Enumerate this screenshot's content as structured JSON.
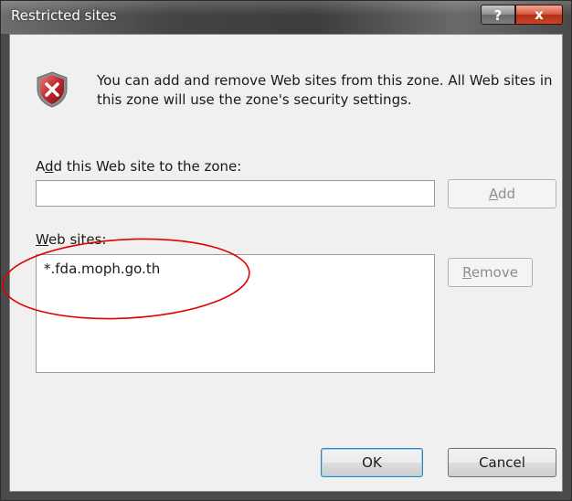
{
  "window": {
    "title": "Restricted sites"
  },
  "title_buttons": {
    "help": "?",
    "close": "x"
  },
  "description": "You can add and remove Web sites from this zone. All Web sites in this zone will use the zone's security settings.",
  "add_site": {
    "label_before": "A",
    "label_mnemonic": "d",
    "label_after": "d this Web site to the zone:",
    "value": "",
    "add_button_mnemonic": "A",
    "add_button_rest": "dd"
  },
  "web_sites": {
    "label_mnemonic": "W",
    "label_rest": "eb sites:",
    "items": [
      "*.fda.moph.go.th"
    ],
    "remove_button_mnemonic": "R",
    "remove_button_rest": "emove"
  },
  "footer": {
    "ok": "OK",
    "cancel": "Cancel"
  },
  "colors": {
    "annotation": "#e00000",
    "shield": "#c0272d"
  },
  "icons": {
    "zone": "shield-error-icon"
  }
}
